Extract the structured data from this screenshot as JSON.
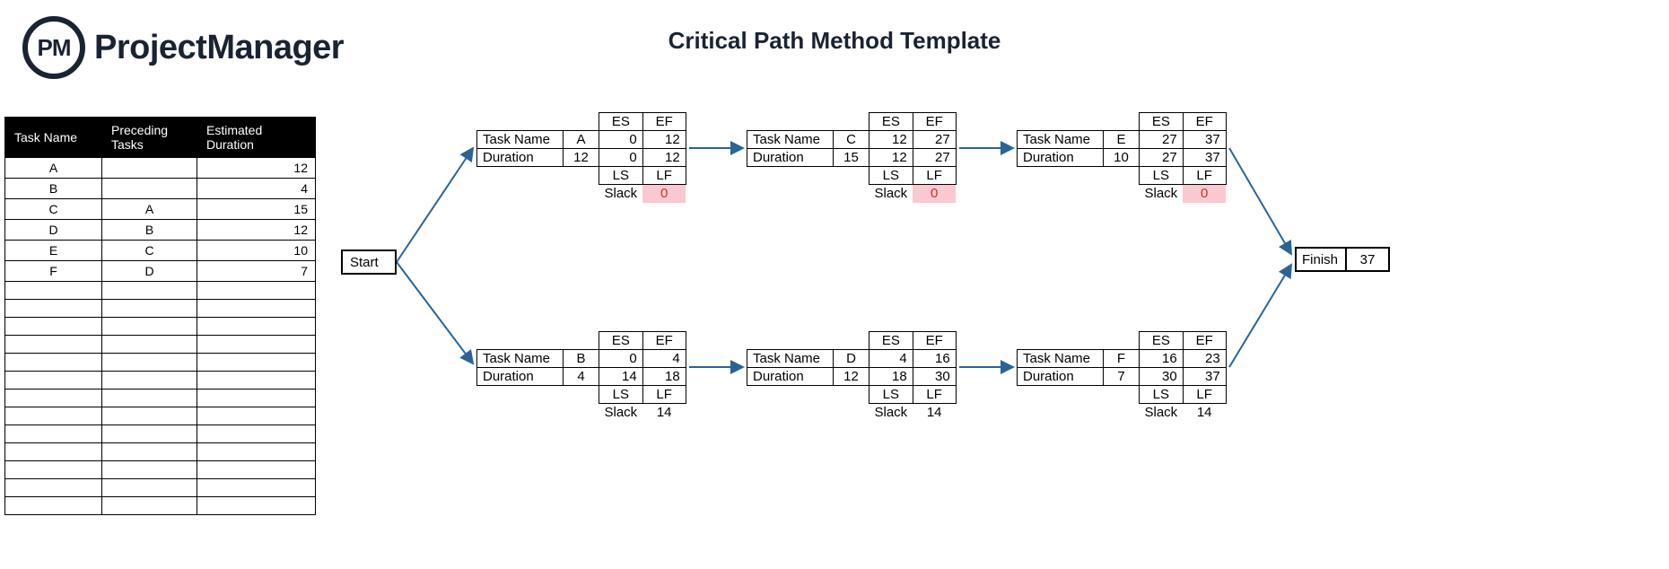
{
  "brand": {
    "abbr": "PM",
    "name": "ProjectManager"
  },
  "title": "Critical Path Method Template",
  "table": {
    "headers": [
      "Task Name",
      "Preceding Tasks",
      "Estimated Duration"
    ],
    "rows": [
      {
        "name": "A",
        "pred": "",
        "dur": "12"
      },
      {
        "name": "B",
        "pred": "",
        "dur": "4"
      },
      {
        "name": "C",
        "pred": "A",
        "dur": "15"
      },
      {
        "name": "D",
        "pred": "B",
        "dur": "12"
      },
      {
        "name": "E",
        "pred": "C",
        "dur": "10"
      },
      {
        "name": "F",
        "pred": "D",
        "dur": "7"
      }
    ],
    "blank_rows": 13
  },
  "diagram": {
    "start_label": "Start",
    "finish_label": "Finish",
    "finish_value": "37",
    "labels": {
      "task_name": "Task Name",
      "duration": "Duration",
      "es": "ES",
      "ef": "EF",
      "ls": "LS",
      "lf": "LF",
      "slack": "Slack"
    },
    "nodes": {
      "a": {
        "name": "A",
        "dur": "12",
        "es": "0",
        "ef": "12",
        "ls": "0",
        "lf": "12",
        "slack": "0",
        "critical": true
      },
      "b": {
        "name": "B",
        "dur": "4",
        "es": "0",
        "ef": "4",
        "ls": "14",
        "lf": "18",
        "slack": "14",
        "critical": false
      },
      "c": {
        "name": "C",
        "dur": "15",
        "es": "12",
        "ef": "27",
        "ls": "12",
        "lf": "27",
        "slack": "0",
        "critical": true
      },
      "d": {
        "name": "D",
        "dur": "12",
        "es": "4",
        "ef": "16",
        "ls": "18",
        "lf": "30",
        "slack": "14",
        "critical": false
      },
      "e": {
        "name": "E",
        "dur": "10",
        "es": "27",
        "ef": "37",
        "ls": "27",
        "lf": "37",
        "slack": "0",
        "critical": true
      },
      "f": {
        "name": "F",
        "dur": "7",
        "es": "16",
        "ef": "23",
        "ls": "30",
        "lf": "37",
        "slack": "14",
        "critical": false
      }
    }
  }
}
